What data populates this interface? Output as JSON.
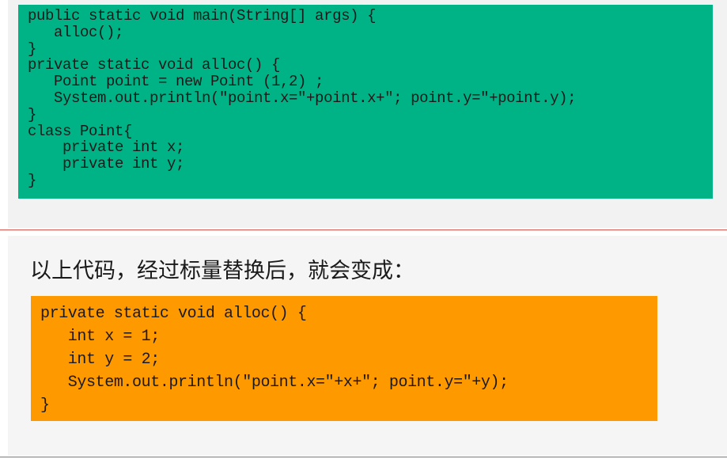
{
  "top_code": {
    "lines": [
      "public static void main(String[] args) {",
      "   alloc();",
      "}",
      "private static void alloc() {",
      "   Point point = new Point (1,2) ;",
      "   System.out.println(\"point.x=\"+point.x+\"; point.y=\"+point.y);",
      "}",
      "class Point{",
      "    private int x;",
      "    private int y;",
      "}"
    ]
  },
  "caption": "以上代码，经过标量替换后，就会变成：",
  "bottom_code": {
    "lines": [
      "private static void alloc() {",
      "   int x = 1;",
      "   int y = 2;",
      "   System.out.println(\"point.x=\"+x+\"; point.y=\"+y);",
      "}"
    ]
  },
  "colors": {
    "green_box": "#00b386",
    "orange_box": "#ff9900",
    "divider": "#d9534f"
  }
}
